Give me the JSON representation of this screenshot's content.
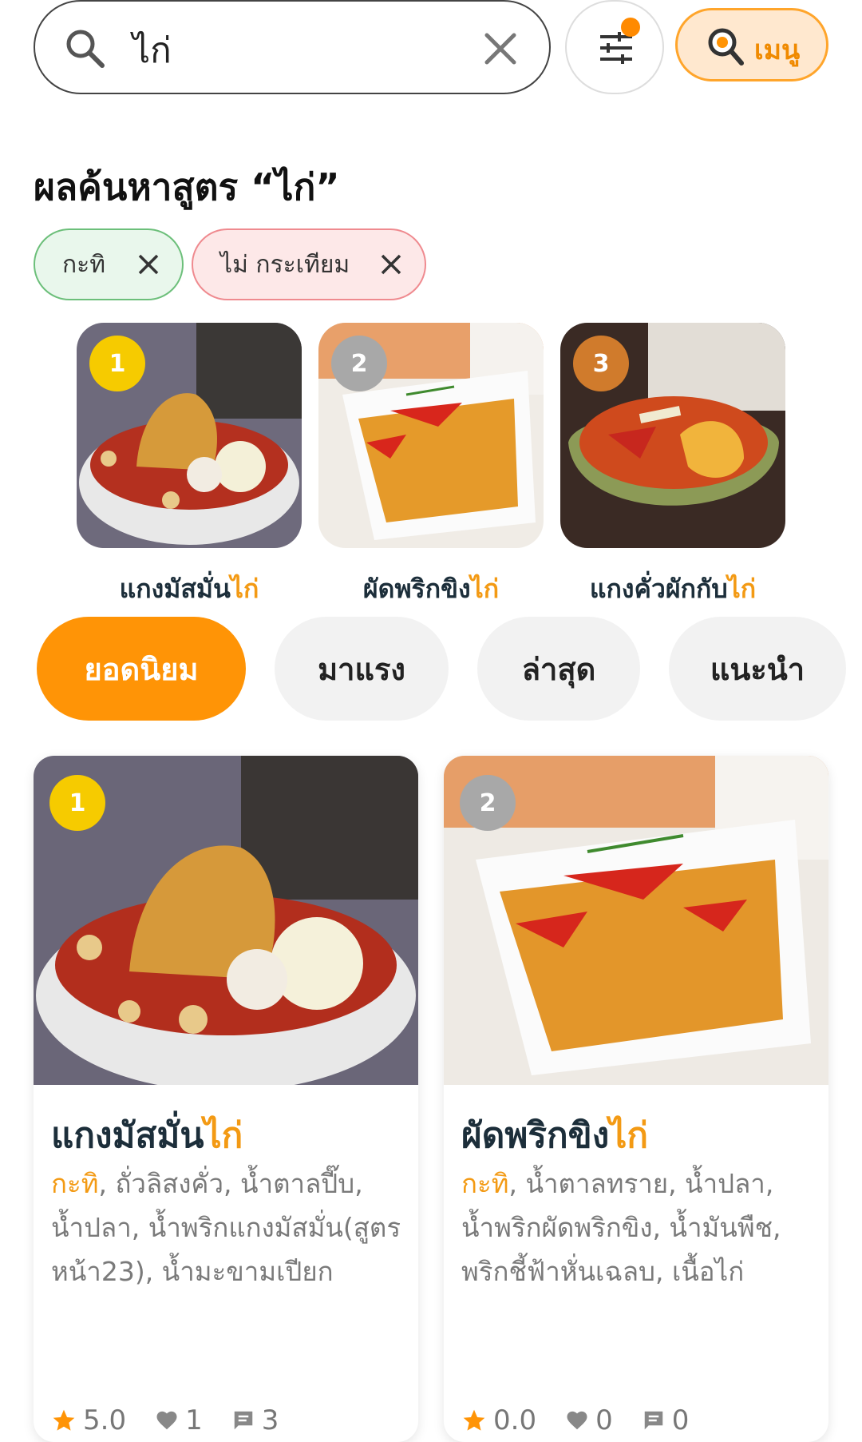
{
  "search": {
    "query": "ไก่"
  },
  "menu_button": {
    "label": "เมนู"
  },
  "colors": {
    "accent": "#FF9406",
    "gold": "#F6CB00",
    "silver": "#A8A8A8",
    "bronze": "#D07B2C"
  },
  "results": {
    "title": "ผลค้นหาสูตร “ไก่”"
  },
  "chips": [
    {
      "label": "กะทิ"
    },
    {
      "label": "ไม่ กระเทียม"
    }
  ],
  "top3": [
    {
      "rank": "1",
      "name_prefix": "แกงมัสมั่น",
      "name_highlight": "ไก่"
    },
    {
      "rank": "2",
      "name_prefix": "ผัดพริกขิง",
      "name_highlight": "ไก่"
    },
    {
      "rank": "3",
      "name_prefix": "แกงคั่วผักกับ",
      "name_highlight": "ไก่"
    }
  ],
  "tabs": [
    {
      "label": "ยอดนิยม",
      "active": true
    },
    {
      "label": "มาแรง"
    },
    {
      "label": "ล่าสุด"
    },
    {
      "label": "แนะนำ"
    }
  ],
  "recipes": [
    {
      "rank": "1",
      "name_prefix": "แกงมัสมั่น",
      "name_highlight": "ไก่",
      "ingredient_highlight": "กะทิ",
      "ingredients_rest": ", ถั่วลิสงคั่ว, น้ำตาลปี๊บ, น้ำปลา, น้ำพริกแกงมัสมั่น(สูตรหน้า23), น้ำมะขามเปียก",
      "rating": "5.0",
      "likes": "1",
      "comments": "3"
    },
    {
      "rank": "2",
      "name_prefix": "ผัดพริกขิง",
      "name_highlight": "ไก่",
      "ingredient_highlight": "กะทิ",
      "ingredients_rest": ", น้ำตาลทราย, น้ำปลา, น้ำพริกผัดพริกขิง, น้ำมันพืช, พริกชี้ฟ้าหั่นเฉลบ, เนื้อไก่",
      "rating": "0.0",
      "likes": "0",
      "comments": "0"
    }
  ]
}
